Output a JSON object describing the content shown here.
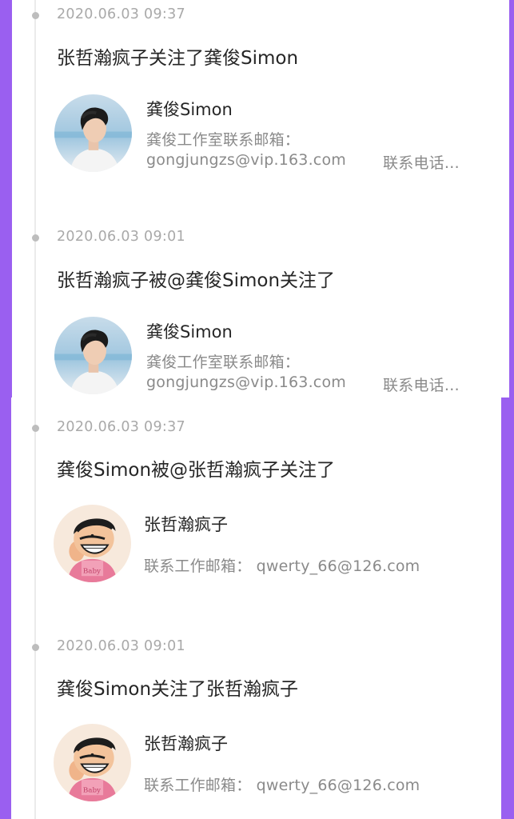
{
  "feed": {
    "entries": [
      {
        "timestamp": "2020.06.03 09:37",
        "headline": "张哲瀚疯子关注了龚俊Simon",
        "user": {
          "name": "龚俊Simon",
          "info_line1": "龚俊工作室联系邮箱：",
          "info_line2": "gongjungzs@vip.163.com",
          "info_line2_right": "联系电话…"
        }
      },
      {
        "timestamp": "2020.06.03 09:01",
        "headline": "张哲瀚疯子被@龚俊Simon关注了",
        "user": {
          "name": "龚俊Simon",
          "info_line1": "龚俊工作室联系邮箱：",
          "info_line2": "gongjungzs@vip.163.com",
          "info_line2_right": "联系电话…"
        }
      },
      {
        "timestamp": "2020.06.03 09:37",
        "headline": "龚俊Simon被@张哲瀚疯子关注了",
        "user": {
          "name": "张哲瀚疯子",
          "info_line1": "联系工作邮箱：  qwerty_66@126.com"
        }
      },
      {
        "timestamp": "2020.06.03 09:01",
        "headline": "龚俊Simon关注了张哲瀚疯子",
        "user": {
          "name": "张哲瀚疯子",
          "info_line1": "联系工作邮箱：  qwerty_66@126.com"
        }
      }
    ]
  },
  "colors": {
    "background_purple": "#9a5ff0",
    "timestamp_gray": "#a9a9a9",
    "headline_dark": "#262626",
    "info_gray": "#8a8a8a",
    "timeline_dot": "#bdbdbd"
  }
}
